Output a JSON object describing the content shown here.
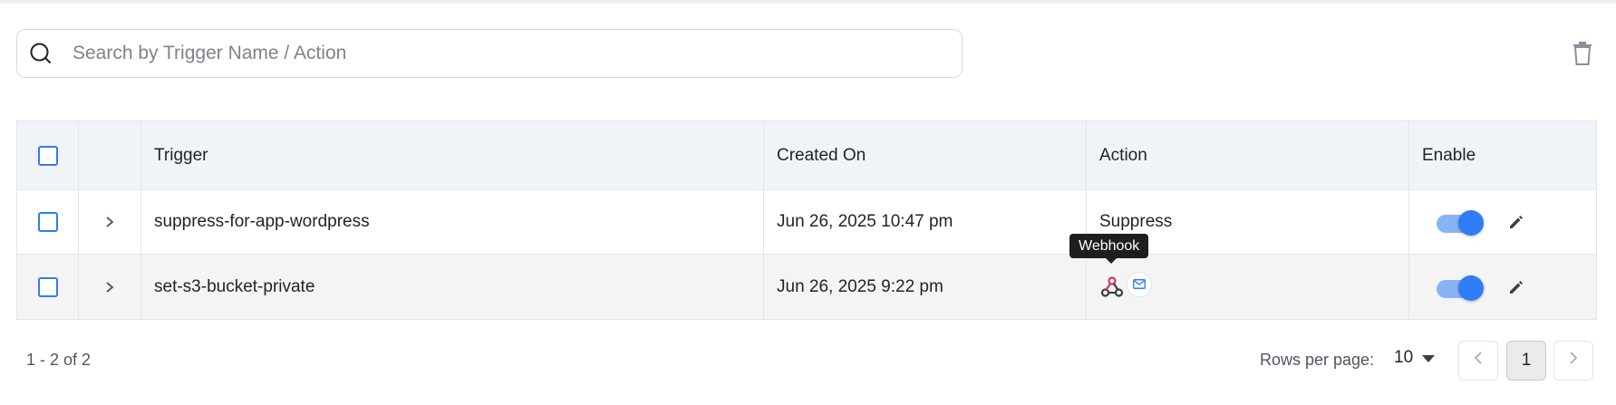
{
  "search": {
    "placeholder": "Search by Trigger Name / Action"
  },
  "table": {
    "columns": {
      "trigger": "Trigger",
      "created_on": "Created On",
      "action": "Action",
      "enable": "Enable"
    },
    "rows": [
      {
        "trigger": "suppress-for-app-wordpress",
        "created_on": "Jun 26, 2025 10:47 pm",
        "action": "Suppress",
        "enabled": true
      },
      {
        "trigger": "set-s3-bucket-private",
        "created_on": "Jun 26, 2025 9:22 pm",
        "action_icons": [
          "webhook-icon",
          "mail-icon"
        ],
        "enabled": true
      }
    ]
  },
  "tooltip": {
    "text": "Webhook"
  },
  "footer": {
    "count": "1 - 2 of 2",
    "rows_per_page_label": "Rows per page:",
    "rows_per_page_value": "10",
    "current_page": "1"
  },
  "colors": {
    "accent": "#2f7cf6",
    "toggle_track": "#88b4f6",
    "header_bg": "#f0f4f9"
  }
}
